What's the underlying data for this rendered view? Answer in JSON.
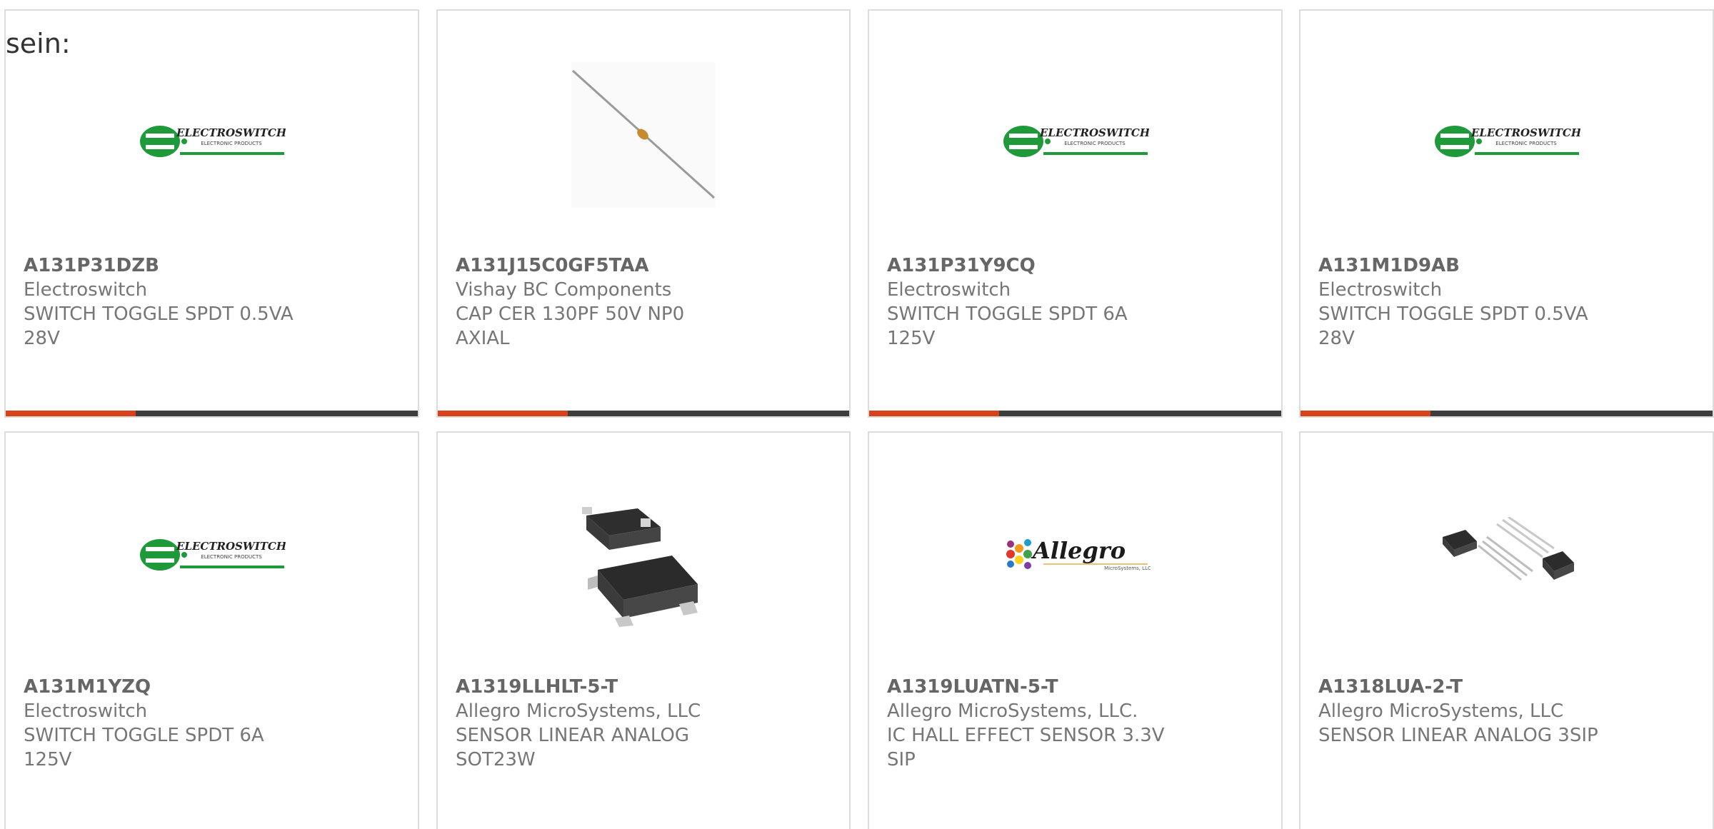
{
  "intro_text": "sein:",
  "colors": {
    "accent": "#d8421b",
    "bar": "#3d3d3d",
    "electroswitch_green": "#1f9a3a",
    "text": "#767676"
  },
  "cards": [
    {
      "pn": "A131P31DZB",
      "mfr": "Electroswitch",
      "desc1": "SWITCH TOGGLE SPDT 0.5VA",
      "desc2": "28V",
      "image": "electroswitch-logo"
    },
    {
      "pn": "A131J15C0GF5TAA",
      "mfr": "Vishay BC Components",
      "desc1": "CAP CER 130PF 50V NP0 AXIAL",
      "desc2": "",
      "image": "axial-capacitor"
    },
    {
      "pn": "A131P31Y9CQ",
      "mfr": "Electroswitch",
      "desc1": "SWITCH TOGGLE SPDT 6A 125V",
      "desc2": "",
      "image": "electroswitch-logo"
    },
    {
      "pn": "A131M1D9AB",
      "mfr": "Electroswitch",
      "desc1": "SWITCH TOGGLE SPDT 0.5VA",
      "desc2": "28V",
      "image": "electroswitch-logo"
    },
    {
      "pn": "A131M1YZQ",
      "mfr": "Electroswitch",
      "desc1": "SWITCH TOGGLE SPDT 6A 125V",
      "desc2": "",
      "image": "electroswitch-logo"
    },
    {
      "pn": "A1319LLHLT-5-T",
      "mfr": "Allegro MicroSystems, LLC",
      "desc1": "SENSOR LINEAR ANALOG",
      "desc2": "SOT23W",
      "image": "sot23-package"
    },
    {
      "pn": "A1319LUATN-5-T",
      "mfr": "Allegro MicroSystems, LLC.",
      "desc1": "IC HALL EFFECT SENSOR 3.3V",
      "desc2": "SIP",
      "image": "allegro-logo"
    },
    {
      "pn": "A1318LUA-2-T",
      "mfr": "Allegro MicroSystems, LLC",
      "desc1": "SENSOR LINEAR ANALOG 3SIP",
      "desc2": "",
      "image": "sip-package"
    }
  ],
  "logos": {
    "electroswitch": {
      "name": "ELECTROSWITCH",
      "tagline": "ELECTRONIC PRODUCTS"
    },
    "allegro": {
      "name": "Allegro",
      "tagline": "MicroSystems, LLC"
    }
  }
}
